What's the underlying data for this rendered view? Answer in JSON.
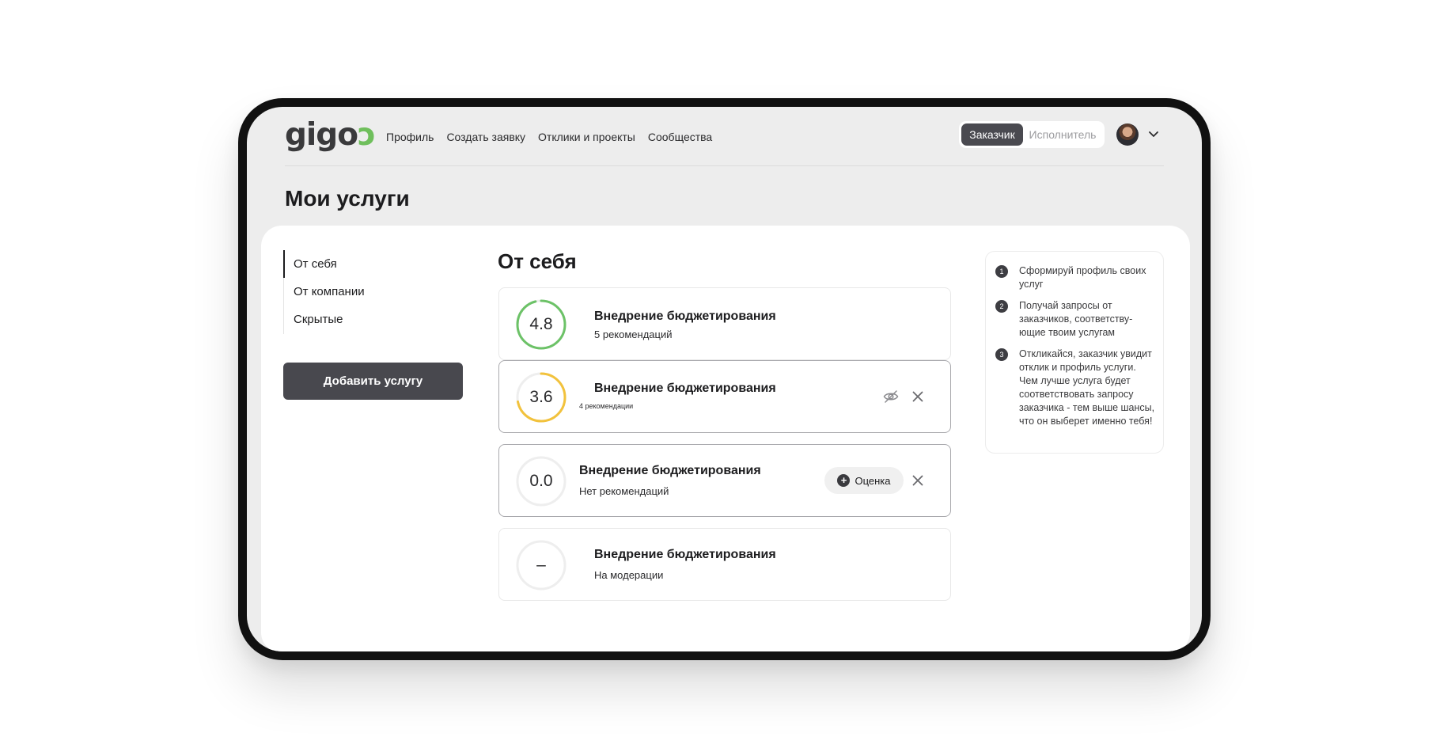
{
  "header": {
    "logo_text": "gigo",
    "logo_accent": "ͻ",
    "nav": [
      "Профиль",
      "Создать заявку",
      "Отклики и проекты",
      "Сообщества"
    ],
    "role_active": "Заказчик",
    "role_inactive": "Исполнитель"
  },
  "page_title": "Мои услуги",
  "sidebar": {
    "items": [
      {
        "label": "От себя",
        "active": true
      },
      {
        "label": "От компании",
        "active": false
      },
      {
        "label": "Скрытые",
        "active": false
      }
    ],
    "add_button": "Добавить услугу"
  },
  "main": {
    "section_title": "От себя",
    "services": [
      {
        "rating": "4.8",
        "title": "Внедрение бюджетирования",
        "subtitle": "5 рекомендаций",
        "ring_color": "#6cc267",
        "ring_fraction": 0.96
      },
      {
        "rating": "3.6",
        "title": "Внедрение бюджетирования",
        "subtitle": "4 рекомендации",
        "ring_color": "#f2c23c",
        "ring_fraction": 0.72
      },
      {
        "rating": "0.0",
        "title": "Внедрение бюджетирования",
        "subtitle": "Нет рекомендаций",
        "rate_button": "Оценка"
      },
      {
        "rating": "–",
        "title": "Внедрение бюджетирования",
        "subtitle": "На модерации"
      }
    ]
  },
  "tips": [
    {
      "num": "1",
      "text": "Сформируй профиль своих услуг"
    },
    {
      "num": "2",
      "text": "Получай запросы от заказчиков, соответству-ющие твоим услугам"
    },
    {
      "num": "3",
      "text": "Откликайся, заказчик увидит отклик и профиль услуги. Чем лучше услуга будет соответствовать запросу заказчика - тем выше шансы, что он выберет именно тебя!"
    }
  ],
  "colors": {
    "accent_green": "#6cc267",
    "accent_yellow": "#f2c23c",
    "dark": "#48484e",
    "logo_green": "#6fbf5c"
  }
}
